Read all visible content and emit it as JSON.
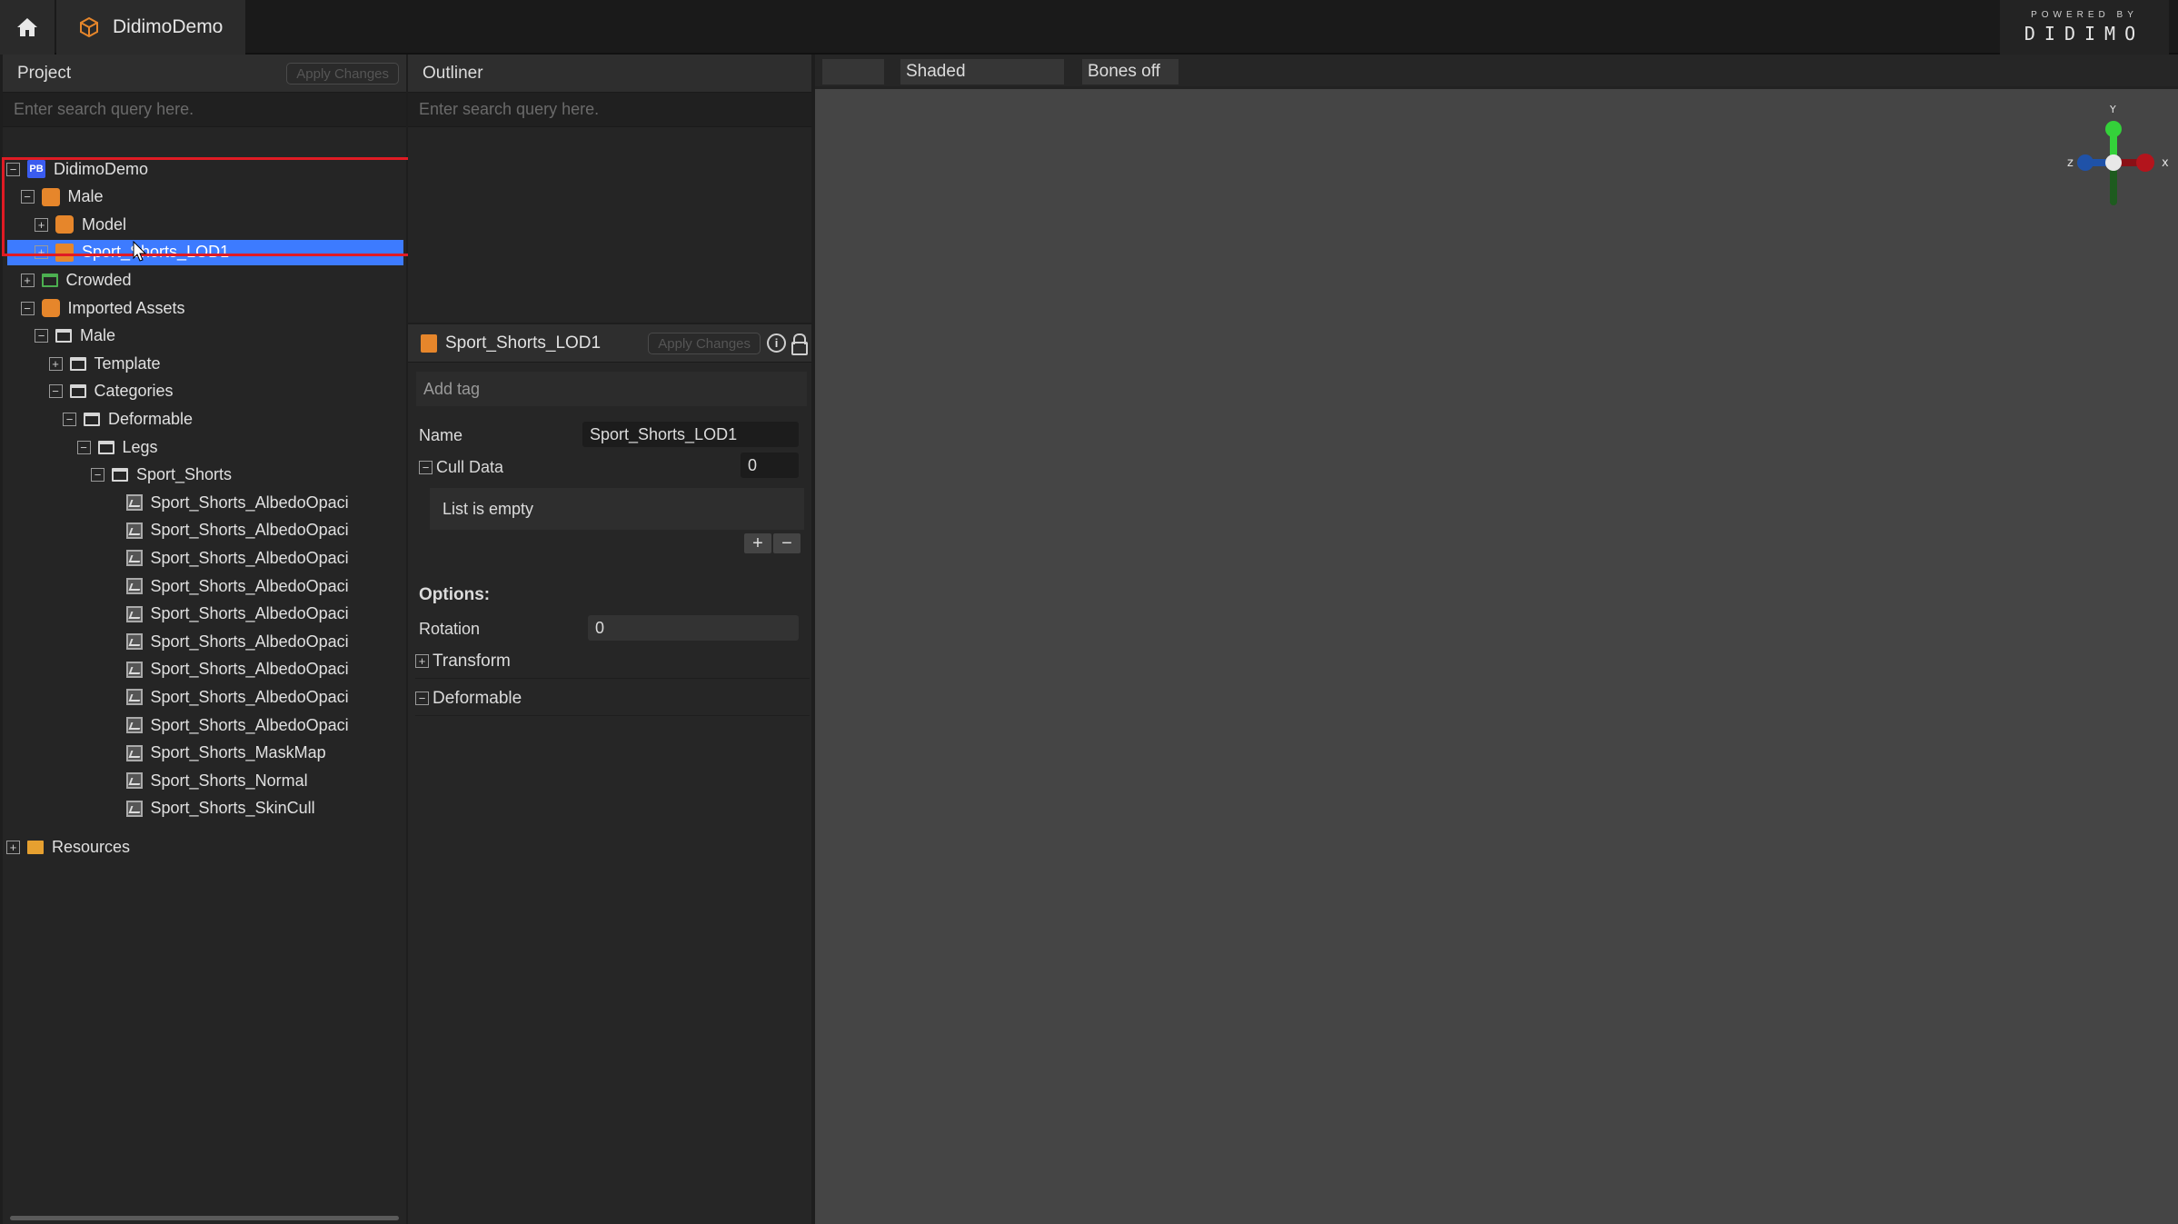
{
  "app": {
    "tab_title": "DidimoDemo",
    "powered_by": "POWERED BY",
    "brand": "DIDIMO"
  },
  "project": {
    "title": "Project",
    "apply_label": "Apply Changes",
    "search_placeholder": "Enter search query here.",
    "tree": [
      {
        "label": "DidimoDemo",
        "indent": 0,
        "expander": "−",
        "icon": "project-icon",
        "icon_text": "PB"
      },
      {
        "label": "Male",
        "indent": 1,
        "expander": "−",
        "icon": "person-icon"
      },
      {
        "label": "Model",
        "indent": 2,
        "expander": "+",
        "icon": "model-icon"
      },
      {
        "label": "Sport_Shorts_LOD1",
        "indent": 2,
        "expander": "+",
        "icon": "shorts-icon",
        "selected": true
      },
      {
        "label": "Crowded",
        "indent": 1,
        "expander": "+",
        "icon": "folder-green-icon"
      },
      {
        "label": "Imported Assets",
        "indent": 1,
        "expander": "−",
        "icon": "model-icon"
      },
      {
        "label": "Male",
        "indent": 2,
        "expander": "−",
        "icon": "folder-icon"
      },
      {
        "label": "Template",
        "indent": 3,
        "expander": "+",
        "icon": "folder-icon"
      },
      {
        "label": "Categories",
        "indent": 3,
        "expander": "−",
        "icon": "folder-icon"
      },
      {
        "label": "Deformable",
        "indent": 4,
        "expander": "−",
        "icon": "folder-icon"
      },
      {
        "label": "Legs",
        "indent": 5,
        "expander": "−",
        "icon": "folder-icon"
      },
      {
        "label": "Sport_Shorts",
        "indent": 6,
        "expander": "−",
        "icon": "folder-icon"
      },
      {
        "label": "Sport_Shorts_AlbedoOpaci",
        "indent": 7,
        "icon": "texture-icon"
      },
      {
        "label": "Sport_Shorts_AlbedoOpaci",
        "indent": 7,
        "icon": "texture-icon"
      },
      {
        "label": "Sport_Shorts_AlbedoOpaci",
        "indent": 7,
        "icon": "texture-icon"
      },
      {
        "label": "Sport_Shorts_AlbedoOpaci",
        "indent": 7,
        "icon": "texture-icon"
      },
      {
        "label": "Sport_Shorts_AlbedoOpaci",
        "indent": 7,
        "icon": "texture-icon"
      },
      {
        "label": "Sport_Shorts_AlbedoOpaci",
        "indent": 7,
        "icon": "texture-icon"
      },
      {
        "label": "Sport_Shorts_AlbedoOpaci",
        "indent": 7,
        "icon": "texture-icon"
      },
      {
        "label": "Sport_Shorts_AlbedoOpaci",
        "indent": 7,
        "icon": "texture-icon"
      },
      {
        "label": "Sport_Shorts_AlbedoOpaci",
        "indent": 7,
        "icon": "texture-icon"
      },
      {
        "label": "Sport_Shorts_MaskMap",
        "indent": 7,
        "icon": "texture-icon"
      },
      {
        "label": "Sport_Shorts_Normal",
        "indent": 7,
        "icon": "texture-icon"
      },
      {
        "label": "Sport_Shorts_SkinCull",
        "indent": 7,
        "icon": "texture-icon"
      },
      {
        "label": "Resources",
        "indent": 0,
        "expander": "+",
        "icon": "folder-orange-icon"
      }
    ]
  },
  "outliner": {
    "title": "Outliner",
    "search_placeholder": "Enter search query here."
  },
  "inspector": {
    "object_name": "Sport_Shorts_LOD1",
    "apply_label": "Apply Changes",
    "add_tag": "Add tag",
    "name_label": "Name",
    "name_value": "Sport_Shorts_LOD1",
    "cull_label": "Cull Data",
    "cull_value": "0",
    "list_empty": "List is empty",
    "plus": "+",
    "minus": "−",
    "options_label": "Options:",
    "rotation_label": "Rotation",
    "rotation_value": "0",
    "transform_label": "Transform",
    "deformable_label": "Deformable"
  },
  "viewport": {
    "mode_blank": "",
    "shading": "Shaded",
    "bones": "Bones off",
    "axis_x": "x",
    "axis_y": "Y",
    "axis_z": "z",
    "colors": {
      "x": "#b3141c",
      "y": "#34d13a",
      "z": "#1f52a8",
      "center": "#e8e8e8"
    }
  }
}
